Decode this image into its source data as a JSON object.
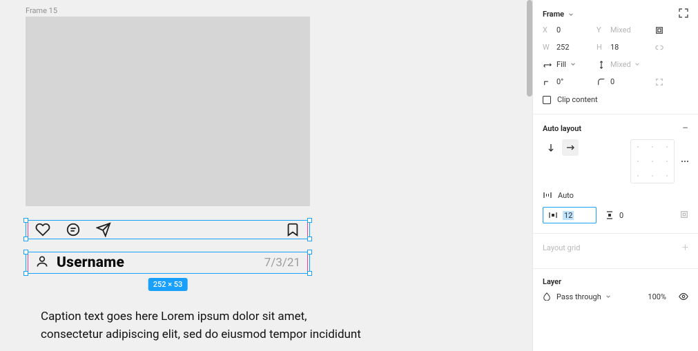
{
  "canvas": {
    "frame_label": "Frame 15",
    "post": {
      "username": "Username",
      "date": "7/3/21",
      "caption": "Caption text goes here Lorem ipsum dolor sit amet, consectetur adipiscing elit, sed do eiusmod tempor incididunt",
      "dim_badge": "252 × 53"
    }
  },
  "panel": {
    "frame": {
      "title": "Frame",
      "x_label": "X",
      "x_value": "0",
      "y_label": "Y",
      "y_value": "Mixed",
      "w_label": "W",
      "w_value": "252",
      "h_label": "H",
      "h_value": "18",
      "resize_h": "Fill",
      "resize_v": "Mixed",
      "rotation": "0°",
      "radius": "0",
      "clip_label": "Clip content"
    },
    "auto_layout": {
      "title": "Auto layout",
      "spacing_mode": "Auto",
      "gap": "12",
      "padding": "0"
    },
    "layout_grid": {
      "title": "Layout grid"
    },
    "layer": {
      "title": "Layer",
      "blend": "Pass through",
      "opacity": "100%"
    }
  }
}
